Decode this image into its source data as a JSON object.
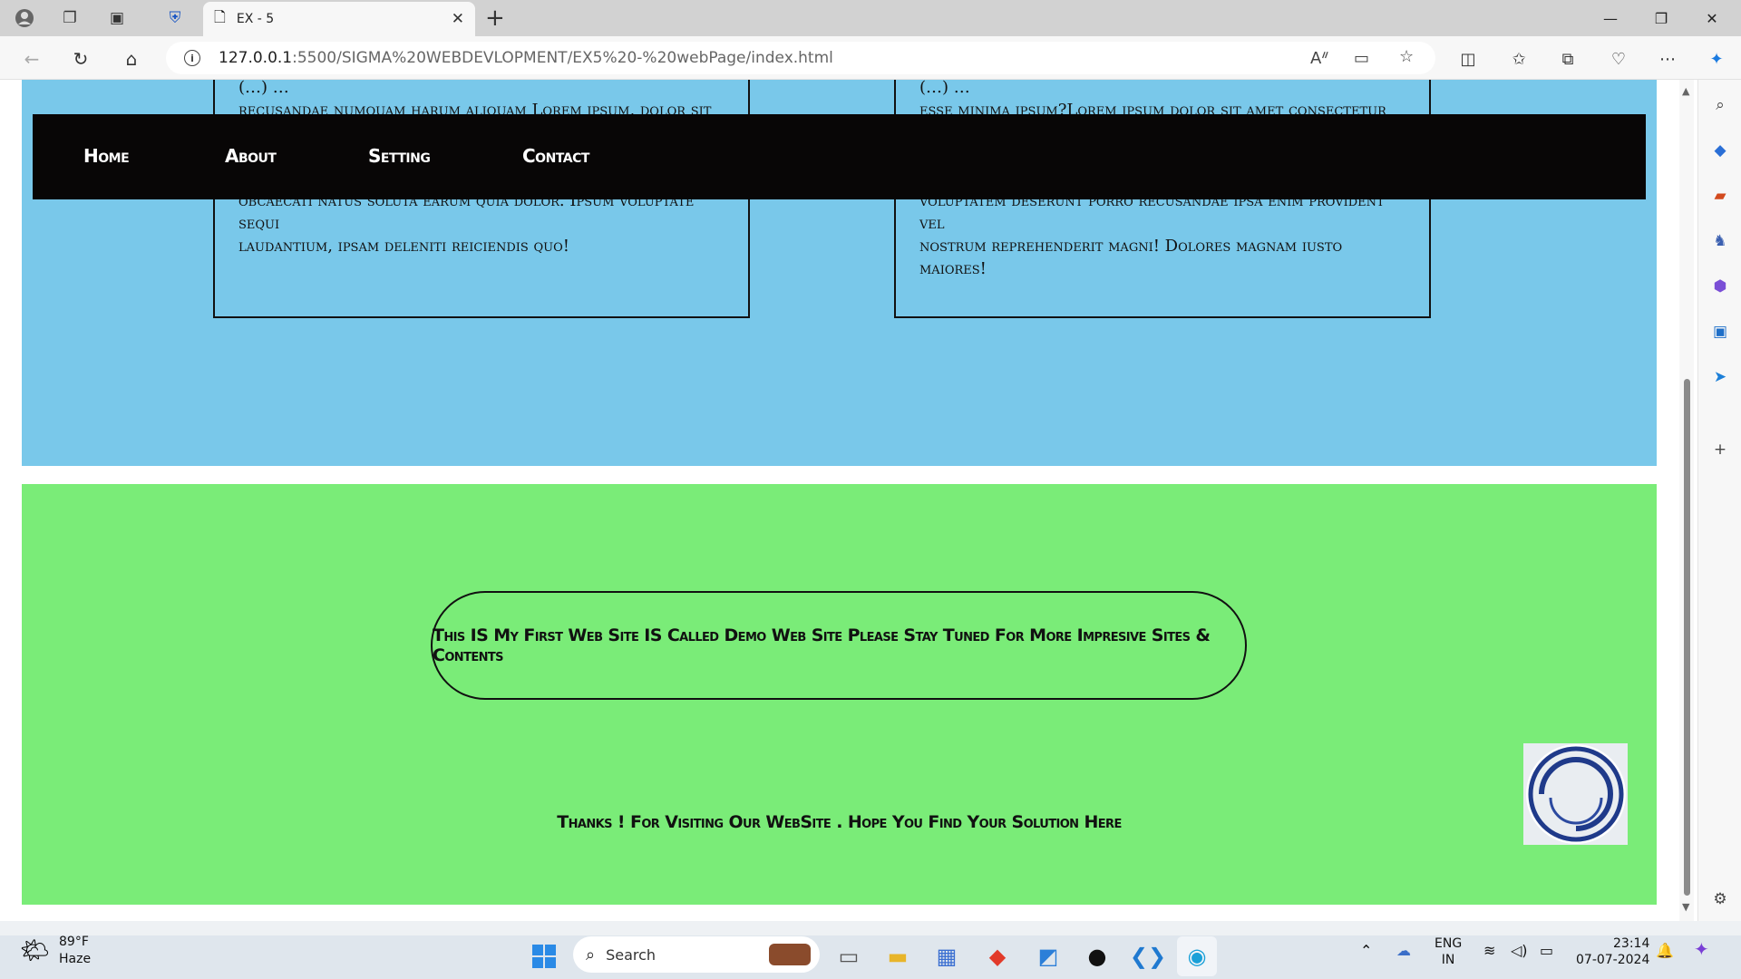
{
  "browser": {
    "tab_title": "EX - 5",
    "url_host": "127.0.0.1",
    "url_rest": ":5500/SIGMA%20WEBDEVLOPMENT/EX5%20-%20webPage/index.html"
  },
  "page": {
    "box_left_text": "(…) … recusandae numquam harum aliquam Lorem ipsum, dolor sit … obcaecati natus soluta earum quia dolor. Ipsum voluptate sequi laudantium, ipsam deleniti reiciendis quo!",
    "box_left_line1": "recusandae numquam harum aliquam Lorem ipsum, dolor sit",
    "box_left_line5": "obcaecati natus soluta earum quia dolor. Ipsum voluptate sequi",
    "box_left_line6": "laudantium, ipsam deleniti reiciendis quo!",
    "box_right_line1": "esse minima ipsum?Lorem ipsum dolor sit amet consectetur",
    "box_right_line5": "voluptatem deserunt porro recusandae ipsa enim provident vel",
    "box_right_line6": "nostrum reprehenderit magni! Dolores magnam iusto maiores!",
    "nav": {
      "home": "Home",
      "about": "About",
      "setting": "Setting",
      "contact": "Contact"
    },
    "pill_text": "This IS My First Web Site IS Called Demo Web Site Please Stay Tuned For More Impresive Sites & Contents",
    "thanks_text": "Thanks ! For Visiting Our WebSite . Hope You Find Your Solution Here"
  },
  "taskbar": {
    "weather_temp": "89°F",
    "weather_desc": "Haze",
    "search_label": "Search",
    "lang_top": "ENG",
    "lang_bottom": "IN",
    "time": "23:14",
    "date": "07-07-2024"
  },
  "colors": {
    "blue_section": "#79c8ea",
    "green_section": "#7aec78",
    "navbar": "#080606"
  }
}
